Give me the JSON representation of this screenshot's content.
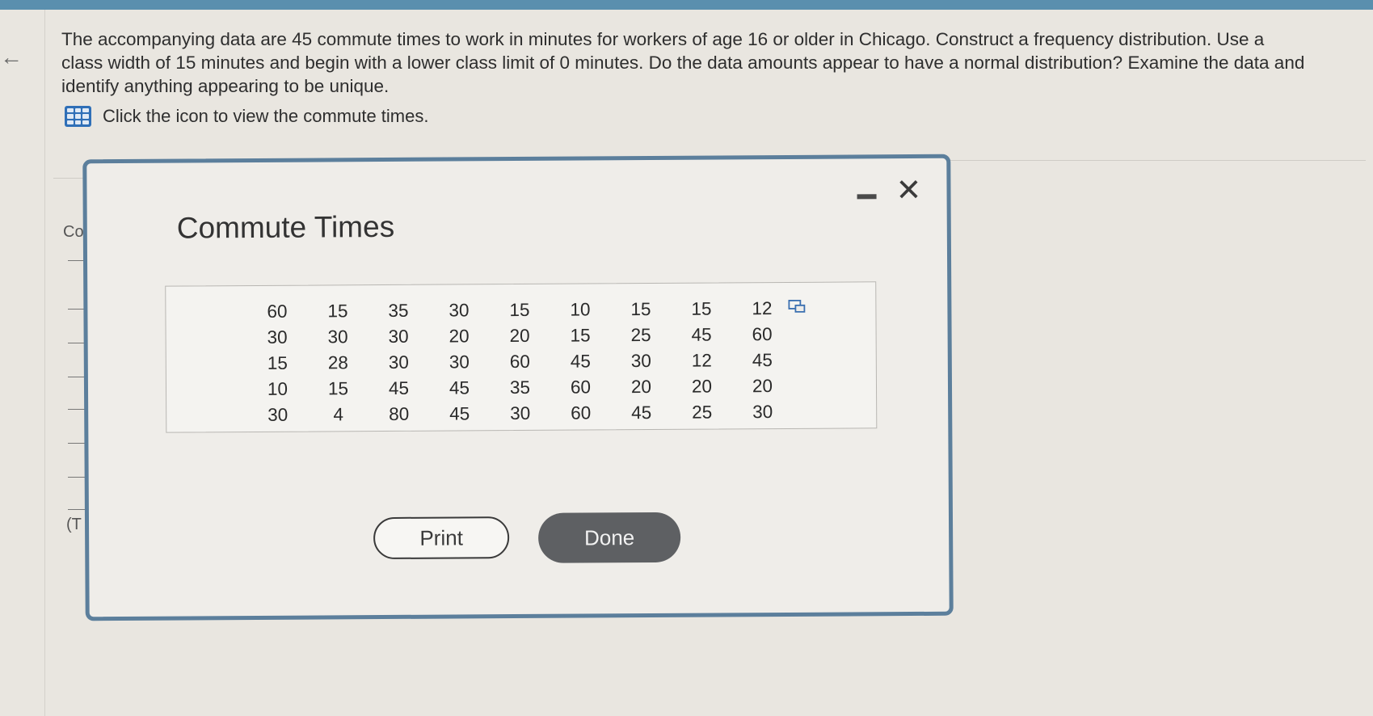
{
  "question": {
    "line1": "The accompanying data are 45 commute times to work in minutes for workers of age 16 or older in Chicago. Construct a frequency distribution. Use a",
    "line2": "class width of 15 minutes and begin with a lower class limit of 0 minutes. Do the data amounts appear to have a normal distribution? Examine the data and",
    "line3": "identify anything appearing to be unique.",
    "hint": "Click the icon to view the commute times."
  },
  "background": {
    "partial_label_top": "Co",
    "partial_label_bottom": "(T"
  },
  "modal": {
    "title": "Commute Times",
    "minimize_icon": "minimize-icon",
    "close_icon": "close-icon",
    "close_glyph": "✕",
    "table": [
      [
        "60",
        "15",
        "35",
        "30",
        "15",
        "10",
        "15",
        "15",
        "12"
      ],
      [
        "30",
        "30",
        "30",
        "20",
        "20",
        "15",
        "25",
        "45",
        "60"
      ],
      [
        "15",
        "28",
        "30",
        "30",
        "60",
        "45",
        "30",
        "12",
        "45"
      ],
      [
        "10",
        "15",
        "45",
        "45",
        "35",
        "60",
        "20",
        "20",
        "20"
      ],
      [
        "30",
        "4",
        "80",
        "45",
        "30",
        "60",
        "45",
        "25",
        "30"
      ]
    ],
    "copy_icon": "copy-icon",
    "print_label": "Print",
    "done_label": "Done"
  }
}
